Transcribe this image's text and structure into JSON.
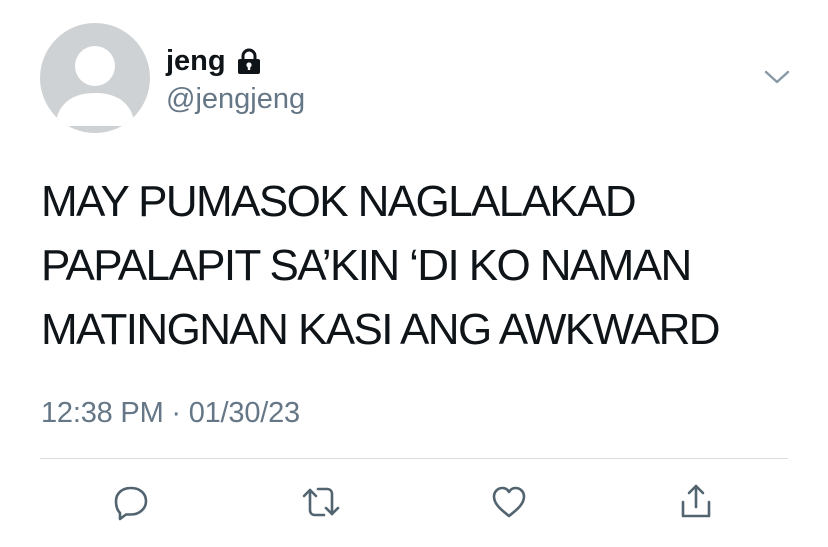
{
  "user": {
    "display_name": "jeng",
    "handle": "@jengjeng",
    "protected_icon": "lock-icon"
  },
  "menu": {
    "icon": "chevron-down-icon"
  },
  "tweet": {
    "lines": [
      "MAY PUMASOK NAGLALAKAD",
      "PAPALAPIT SA’KIN ‘DI KO NAMAN",
      "MATINGNAN KASI ANG AWKWARD"
    ],
    "timestamp": "12:38 PM · 01/30/23"
  },
  "actions": [
    {
      "name": "reply",
      "icon": "reply-icon"
    },
    {
      "name": "retweet",
      "icon": "retweet-icon"
    },
    {
      "name": "like",
      "icon": "heart-icon"
    },
    {
      "name": "share",
      "icon": "share-icon"
    }
  ],
  "colors": {
    "text": "#0f1419",
    "secondary": "#657786",
    "icon": "#536471",
    "avatar_bg": "#cfd2d4",
    "divider": "#d8dde1"
  }
}
